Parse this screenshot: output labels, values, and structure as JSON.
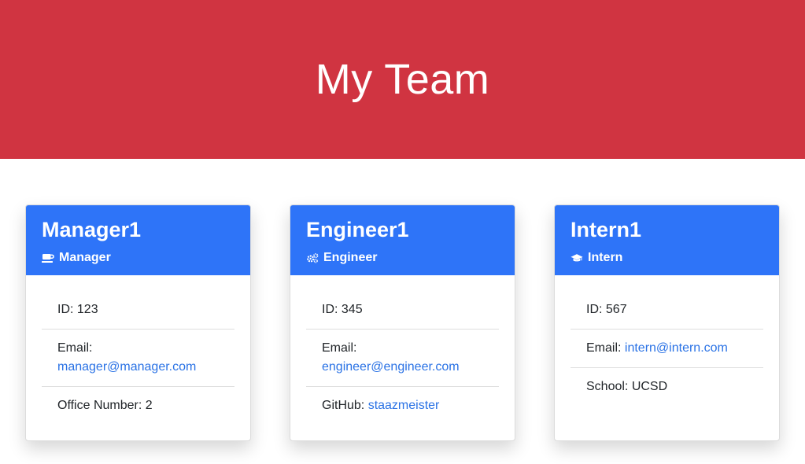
{
  "header": {
    "title": "My Team"
  },
  "team": [
    {
      "name": "Manager1",
      "role": "Manager",
      "role_icon": "coffee-mug-icon",
      "id_label": "ID: ",
      "id": "123",
      "email_label": "Email: ",
      "email": "manager@manager.com",
      "extra_label": "Office Number: ",
      "extra_value": "2"
    },
    {
      "name": "Engineer1",
      "role": "Engineer",
      "role_icon": "cogs-icon",
      "id_label": "ID: ",
      "id": "345",
      "email_label": "Email: ",
      "email": "engineer@engineer.com",
      "extra_label": "GitHub: ",
      "extra_value": "staazmeister"
    },
    {
      "name": "Intern1",
      "role": "Intern",
      "role_icon": "graduation-cap-icon",
      "id_label": "ID: ",
      "id": "567",
      "email_label": "Email: ",
      "email": "intern@intern.com",
      "extra_label": "School: ",
      "extra_value": "UCSD"
    }
  ],
  "colors": {
    "header_bg": "#d03441",
    "card_header_bg": "#2e74f8",
    "link": "#2a72e5"
  }
}
